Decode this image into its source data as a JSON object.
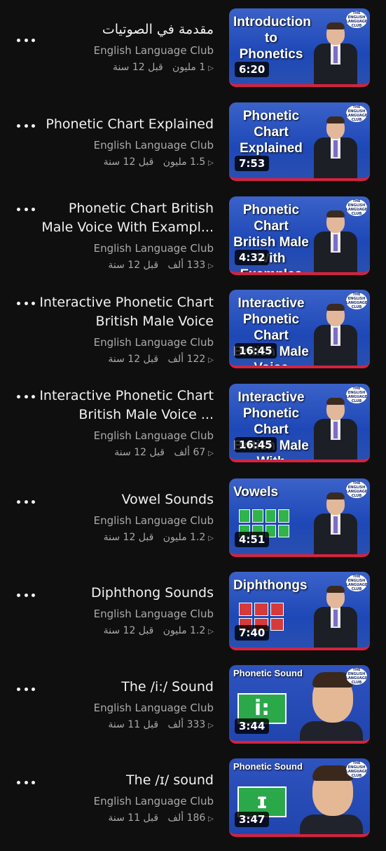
{
  "videos": [
    {
      "title": "مقدمة في الصوتيات",
      "channel": "English Language Club",
      "views": "1 مليون",
      "age": "قبل 12 سنة",
      "duration": "6:20",
      "thumb_text": "Introduction to Phonetics"
    },
    {
      "title": "Phonetic Chart Explained",
      "channel": "English Language Club",
      "views": "1.5 مليون",
      "age": "قبل 12 سنة",
      "duration": "7:53",
      "thumb_text": "Phonetic Chart Explained"
    },
    {
      "title": "Phonetic Chart British Male Voice With Exampl...",
      "channel": "English Language Club",
      "views": "133 ألف",
      "age": "قبل 12 سنة",
      "duration": "4:32",
      "thumb_text": "Phonetic Chart British Male With Examples"
    },
    {
      "title": "Interactive Phonetic Chart British Male Voice",
      "channel": "English Language Club",
      "views": "122 ألف",
      "age": "قبل 12 سنة",
      "duration": "16:45",
      "thumb_text": "Interactive Phonetic Chart British Male Voice"
    },
    {
      "title": "Interactive Phonetic Chart British Male Voice ...",
      "channel": "English Language Club",
      "views": "67 ألف",
      "age": "قبل 12 سنة",
      "duration": "16:45",
      "thumb_text": "Interactive Phonetic Chart British Male With Examples"
    },
    {
      "title": "Vowel Sounds",
      "channel": "English Language Club",
      "views": "1.2 مليون",
      "age": "قبل 12 سنة",
      "duration": "4:51",
      "thumb_text": "Vowels"
    },
    {
      "title": "Diphthong Sounds",
      "channel": "English Language Club",
      "views": "1.2 مليون",
      "age": "قبل 12 سنة",
      "duration": "7:40",
      "thumb_text": "Diphthongs"
    },
    {
      "title": "The /i:/ Sound",
      "channel": "English Language Club",
      "views": "333 ألف",
      "age": "قبل 11 سنة",
      "duration": "3:44",
      "thumb_text": "Phonetic Sound",
      "symbol": "i:"
    },
    {
      "title": "The /ɪ/ sound",
      "channel": "English Language Club",
      "views": "186 ألف",
      "age": "قبل 11 سنة",
      "duration": "3:47",
      "thumb_text": "Phonetic Sound",
      "symbol": "ɪ"
    }
  ],
  "badge_text": "THE ENGLISH LANGUAGE CLUB",
  "icons": {
    "more": "more-vertical-dots-icon",
    "play": "play-outline-icon"
  }
}
